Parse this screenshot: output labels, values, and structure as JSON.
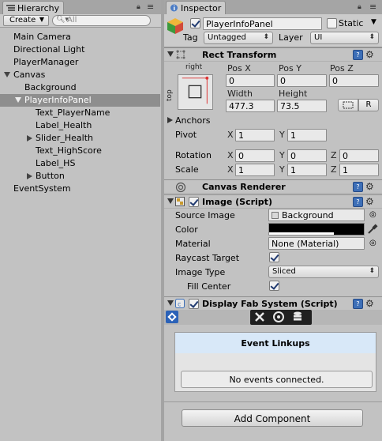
{
  "hierarchy": {
    "tab_label": "Hierarchy",
    "create_label": "Create",
    "search_placeholder": "All",
    "items": [
      {
        "label": "Main Camera"
      },
      {
        "label": "Directional Light"
      },
      {
        "label": "PlayerManager"
      },
      {
        "label": "Canvas"
      },
      {
        "label": "Background"
      },
      {
        "label": "PlayerInfoPanel"
      },
      {
        "label": "Text_PlayerName"
      },
      {
        "label": "Label_Health"
      },
      {
        "label": "Slider_Health"
      },
      {
        "label": "Text_HighScore"
      },
      {
        "label": "Label_HS"
      },
      {
        "label": "Button"
      },
      {
        "label": "EventSystem"
      }
    ]
  },
  "inspector": {
    "tab_label": "Inspector",
    "object_name": "PlayerInfoPanel",
    "static_label": "Static",
    "tag_label": "Tag",
    "tag_value": "Untagged",
    "layer_label": "Layer",
    "layer_value": "UI",
    "rect_transform": {
      "title": "Rect Transform",
      "anchor_h": "right",
      "anchor_v": "top",
      "pos_x_label": "Pos X",
      "pos_y_label": "Pos Y",
      "pos_z_label": "Pos Z",
      "pos_x": "0",
      "pos_y": "0",
      "pos_z": "0",
      "width_label": "Width",
      "height_label": "Height",
      "width": "477.3",
      "height": "73.5",
      "r_button": "R",
      "anchors_label": "Anchors",
      "pivot_label": "Pivot",
      "pivot_x": "1",
      "pivot_y": "1",
      "rotation_label": "Rotation",
      "rot_x": "0",
      "rot_y": "0",
      "rot_z": "0",
      "scale_label": "Scale",
      "scale_x": "1",
      "scale_y": "1",
      "scale_z": "1",
      "x": "X",
      "y": "Y",
      "z": "Z"
    },
    "canvas_renderer": {
      "title": "Canvas Renderer"
    },
    "image": {
      "title": "Image (Script)",
      "source_image_label": "Source Image",
      "source_image_value": "Background",
      "color_label": "Color",
      "material_label": "Material",
      "material_value": "None (Material)",
      "raycast_label": "Raycast Target",
      "image_type_label": "Image Type",
      "image_type_value": "Sliced",
      "fill_center_label": "Fill Center"
    },
    "display_fab": {
      "title": "Display Fab System (Script)",
      "event_linkups_title": "Event Linkups",
      "no_events_text": "No events connected."
    },
    "add_component_label": "Add Component"
  }
}
